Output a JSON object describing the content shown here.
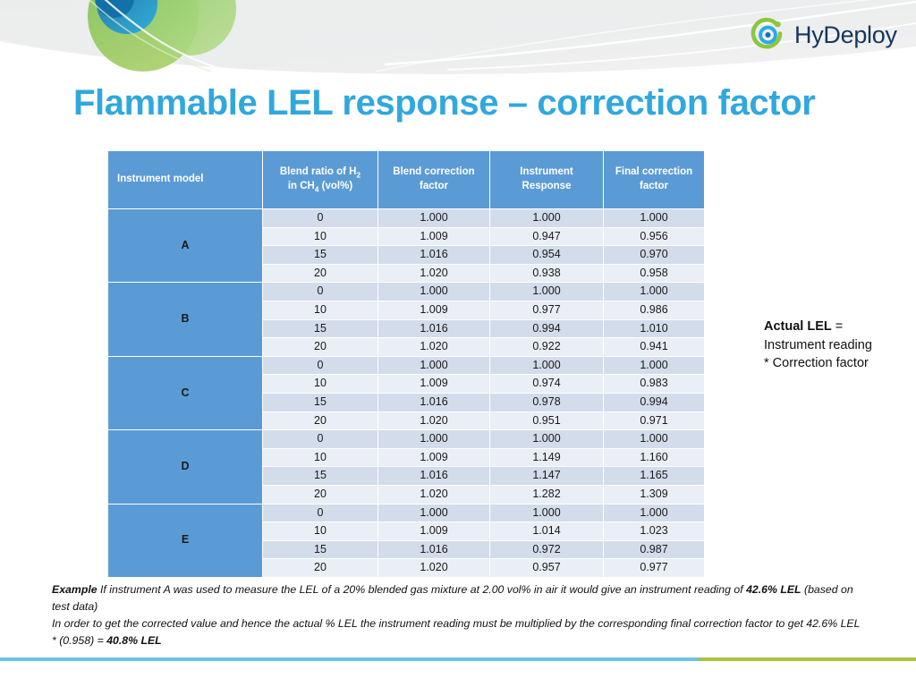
{
  "brand": {
    "logo_text": "HyDeploy",
    "logo_icon": "hydeploy-atom-logo",
    "ring_color": "#8cc63e",
    "core_color": "#29abe2",
    "word_color": "#15355c"
  },
  "title": "Flammable LEL response – correction factor",
  "title_color": "#31a8dd",
  "table": {
    "header_color": "#5b9bd5",
    "columns": [
      {
        "key": "model",
        "label_parts": [
          "Instrument model"
        ]
      },
      {
        "key": "ratio",
        "label_parts": [
          "Blend ratio of H",
          "2",
          " in CH",
          "4",
          " (vol%)"
        ]
      },
      {
        "key": "blend",
        "label_parts": [
          "Blend correction factor"
        ]
      },
      {
        "key": "resp",
        "label_parts": [
          "Instrument Response"
        ]
      },
      {
        "key": "final",
        "label_parts": [
          "Final correction factor"
        ]
      }
    ],
    "header_model": "Instrument model",
    "header_ratio_l1_a": "Blend ratio of H",
    "header_ratio_l1_sub": "2",
    "header_ratio_l2_a": "in CH",
    "header_ratio_l2_sub": "4",
    "header_ratio_l2_b": " (vol%)",
    "header_blend_l1": "Blend correction",
    "header_blend_l2": "factor",
    "header_resp_l1": "Instrument",
    "header_resp_l2": "Response",
    "header_final_l1": "Final correction",
    "header_final_l2": "factor",
    "groups": [
      {
        "model": "A",
        "rows": [
          {
            "ratio": "0",
            "blend": "1.000",
            "resp": "1.000",
            "final": "1.000"
          },
          {
            "ratio": "10",
            "blend": "1.009",
            "resp": "0.947",
            "final": "0.956"
          },
          {
            "ratio": "15",
            "blend": "1.016",
            "resp": "0.954",
            "final": "0.970"
          },
          {
            "ratio": "20",
            "blend": "1.020",
            "resp": "0.938",
            "final": "0.958"
          }
        ]
      },
      {
        "model": "B",
        "rows": [
          {
            "ratio": "0",
            "blend": "1.000",
            "resp": "1.000",
            "final": "1.000"
          },
          {
            "ratio": "10",
            "blend": "1.009",
            "resp": "0.977",
            "final": "0.986"
          },
          {
            "ratio": "15",
            "blend": "1.016",
            "resp": "0.994",
            "final": "1.010"
          },
          {
            "ratio": "20",
            "blend": "1.020",
            "resp": "0.922",
            "final": "0.941"
          }
        ]
      },
      {
        "model": "C",
        "rows": [
          {
            "ratio": "0",
            "blend": "1.000",
            "resp": "1.000",
            "final": "1.000"
          },
          {
            "ratio": "10",
            "blend": "1.009",
            "resp": "0.974",
            "final": "0.983"
          },
          {
            "ratio": "15",
            "blend": "1.016",
            "resp": "0.978",
            "final": "0.994"
          },
          {
            "ratio": "20",
            "blend": "1.020",
            "resp": "0.951",
            "final": "0.971"
          }
        ]
      },
      {
        "model": "D",
        "rows": [
          {
            "ratio": "0",
            "blend": "1.000",
            "resp": "1.000",
            "final": "1.000"
          },
          {
            "ratio": "10",
            "blend": "1.009",
            "resp": "1.149",
            "final": "1.160"
          },
          {
            "ratio": "15",
            "blend": "1.016",
            "resp": "1.147",
            "final": "1.165"
          },
          {
            "ratio": "20",
            "blend": "1.020",
            "resp": "1.282",
            "final": "1.309"
          }
        ]
      },
      {
        "model": "E",
        "rows": [
          {
            "ratio": "0",
            "blend": "1.000",
            "resp": "1.000",
            "final": "1.000"
          },
          {
            "ratio": "10",
            "blend": "1.009",
            "resp": "1.014",
            "final": "1.023"
          },
          {
            "ratio": "15",
            "blend": "1.016",
            "resp": "0.972",
            "final": "0.987"
          },
          {
            "ratio": "20",
            "blend": "1.020",
            "resp": "0.957",
            "final": "0.977"
          }
        ]
      }
    ]
  },
  "side_note": {
    "bold_lead": "Actual LEL",
    "line1_rest": " =",
    "line2": "Instrument reading",
    "line3": "* Correction factor"
  },
  "footnote": {
    "p1_bold": "Example",
    "p1_a": " If instrument A was used to measure the LEL of a 20% blended gas mixture at 2.00 vol% in air it would give an instrument reading of ",
    "p1_bold2": "42.6% LEL",
    "p1_b": " (based on test data)",
    "p2_a": "In order to get the corrected value and hence the actual % LEL the instrument reading must be multiplied by the corresponding final correction factor to get 42.6% LEL * (0.958) = ",
    "p2_bold": "40.8% LEL"
  },
  "footer_bars": {
    "blue": "#6cc5e8",
    "green": "#a9c23f"
  }
}
